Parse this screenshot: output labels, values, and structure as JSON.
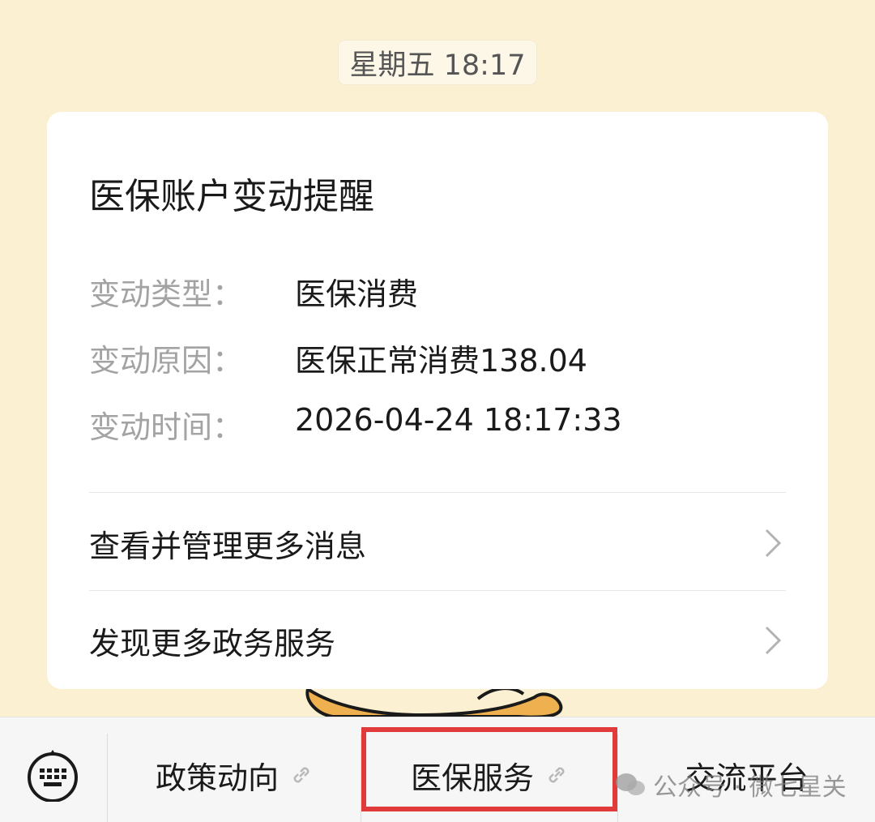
{
  "chat": {
    "timestamp": "星期五 18:17"
  },
  "card": {
    "title": "医保账户变动提醒",
    "fields": [
      {
        "label": "变动类型：",
        "value": "医保消费"
      },
      {
        "label": "变动原因：",
        "value": "医保正常消费138.04"
      },
      {
        "label": "变动时间：",
        "value": "2026-04-24 18:17:33"
      }
    ],
    "links": [
      {
        "label": "查看并管理更多消息",
        "icon": "chevron-right-icon"
      },
      {
        "label": "发现更多政务服务",
        "icon": "chevron-right-icon"
      }
    ]
  },
  "menu": {
    "keyboard_icon": "keyboard-icon",
    "items": [
      {
        "label": "政策动向",
        "icon": "link-icon"
      },
      {
        "label": "医保服务",
        "icon": "link-icon",
        "highlighted": true
      },
      {
        "label": "交流平台"
      }
    ]
  },
  "watermark": {
    "text": "公众号 · 微七星关"
  },
  "colors": {
    "background": "#fcf0d2",
    "card": "#ffffff",
    "highlight_border": "#e03a3a",
    "bottom_bar": "#f6f6f6"
  }
}
